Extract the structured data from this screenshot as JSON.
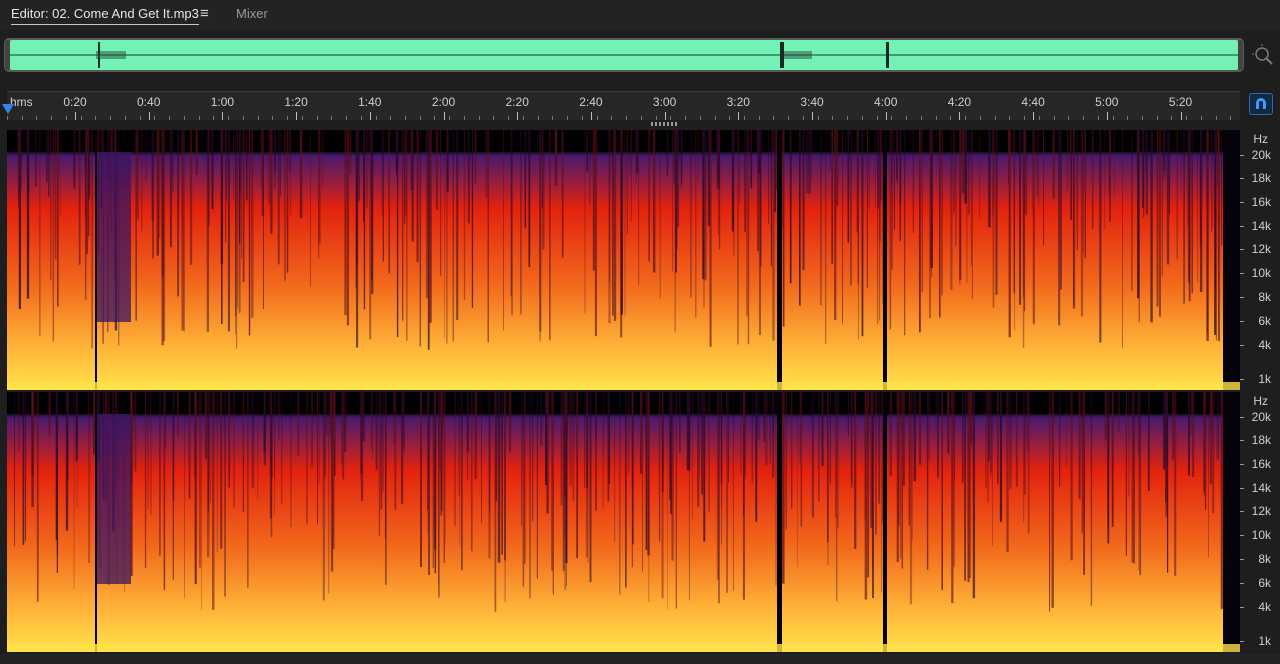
{
  "tabs": {
    "editor_label": "Editor: 02. Come And Get It.mp3",
    "menu_icon": "hamburger-menu-icon",
    "mixer_label": "Mixer"
  },
  "overview": {
    "zoom_icon": "zoom-selection-icon"
  },
  "timeline": {
    "unit_label": "hms",
    "ticks": [
      "0:20",
      "0:40",
      "1:00",
      "1:20",
      "1:40",
      "2:00",
      "2:20",
      "2:40",
      "3:00",
      "3:20",
      "3:40",
      "4:00",
      "4:20",
      "4:40",
      "5:00",
      "5:20"
    ],
    "snap_icon": "snap-magnet-icon"
  },
  "spectral": {
    "unit_label": "Hz",
    "freq_labels": [
      "20k",
      "18k",
      "16k",
      "14k",
      "12k",
      "10k",
      "8k",
      "6k",
      "4k",
      "1k"
    ]
  },
  "colors": {
    "waveform_green": "#73f2b6",
    "playhead_blue": "#2f86e6",
    "spectrum_low": "#ffe24a",
    "spectrum_mid": "#e2220e",
    "spectrum_high": "#4a1a6e"
  }
}
